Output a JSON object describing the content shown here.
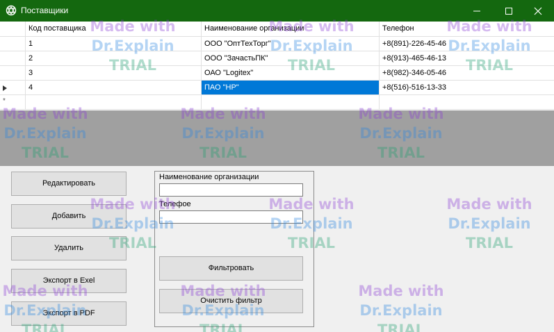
{
  "window": {
    "title": "Поставщики",
    "colors": {
      "titlebar": "#14680f",
      "selection": "#0078d7"
    },
    "controls": [
      "minimize-icon",
      "maximize-icon",
      "close-icon"
    ]
  },
  "grid": {
    "columns": [
      "Код поставщика",
      "Наименование организации",
      "Телефон"
    ],
    "rows": [
      {
        "code": "1",
        "name": "ООО \"ОптТехТорг\"",
        "phone": "+8(891)-226-45-46"
      },
      {
        "code": "2",
        "name": "ООО \"ЗачастьПК\"",
        "phone": "+8(913)-465-46-13"
      },
      {
        "code": "3",
        "name": "ОАО \"Logitex\"",
        "phone": "+8(982)-346-05-46"
      },
      {
        "code": "4",
        "name": "ПАО \"HP\"",
        "phone": "+8(516)-516-13-33"
      }
    ],
    "current_row_marker": "►",
    "new_row_marker": "*"
  },
  "actions": {
    "edit": "Редактировать",
    "add": "Добавить",
    "delete": "Удалить",
    "export_excel": "Экспорт в Exel",
    "export_pdf": "Экспорт в PDF"
  },
  "filter": {
    "org_label": "Наименование организации",
    "org_value": "",
    "phone_label": "Телефое",
    "phone_value": "",
    "filter_button": "Фильтровать",
    "clear_button": "Очистить фильтр"
  },
  "watermark": {
    "line1": "Made with",
    "line2": "Dr.Explain",
    "line3": "TRIAL"
  }
}
